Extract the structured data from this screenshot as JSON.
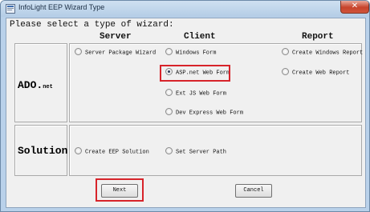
{
  "window": {
    "title": "InfoLight EEP Wizard Type",
    "close_glyph": "✕"
  },
  "prompt": "Please select a type of wizard:",
  "columns": [
    "Server",
    "Client",
    "Report"
  ],
  "rows": {
    "ado": {
      "label": "ADO.",
      "label_suffix": "net"
    },
    "solution": {
      "label": "Solution"
    }
  },
  "options": {
    "server_package_wizard": "Server Package Wizard",
    "windows_form": "Windows Form",
    "aspnet_web_form": "ASP.net Web Form",
    "extjs_web_form": "Ext JS Web Form",
    "devexpress_web_form": "Dev Express Web Form",
    "create_windows_report": "Create Windows Report",
    "create_web_report": "Create Web Report",
    "create_eep_solution": "Create EEP Solution",
    "set_server_path": "Set Server Path"
  },
  "selected": "ASP.net Web Form",
  "buttons": {
    "next": "Next",
    "cancel": "Cancel"
  },
  "colors": {
    "highlight": "#d7232a",
    "titlebar": "#b9d1ea"
  }
}
